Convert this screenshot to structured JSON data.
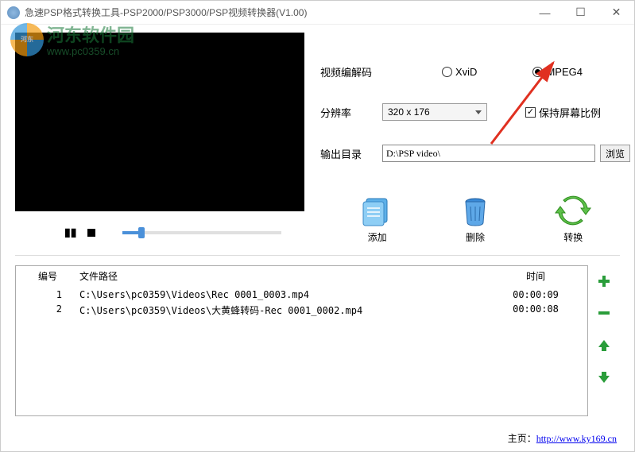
{
  "titlebar": {
    "title": "急速PSP格式转换工具-PSP2000/PSP3000/PSP视频转换器(V1.00)"
  },
  "watermark": {
    "brand": "河东软件园",
    "url": "www.pc0359.cn"
  },
  "settings": {
    "codec_label": "视频编解码",
    "codec_options": {
      "xvid": "XviD",
      "mpeg4": "MPEG4"
    },
    "codec_selected": "mpeg4",
    "resolution_label": "分辨率",
    "resolution_value": "320 x 176",
    "keep_aspect_label": "保持屏幕比例",
    "keep_aspect_checked": true,
    "outdir_label": "输出目录",
    "outdir_value": "D:\\PSP video\\",
    "browse_label": "浏览"
  },
  "actions": {
    "add": "添加",
    "delete": "删除",
    "convert": "转换"
  },
  "table": {
    "headers": {
      "num": "编号",
      "path": "文件路径",
      "time": "时间"
    },
    "rows": [
      {
        "num": "1",
        "path": "C:\\Users\\pc0359\\Videos\\Rec 0001_0003.mp4",
        "time": "00:00:09"
      },
      {
        "num": "2",
        "path": "C:\\Users\\pc0359\\Videos\\大黄蜂转码-Rec 0001_0002.mp4",
        "time": "00:00:08"
      }
    ]
  },
  "footer": {
    "label": "主页：",
    "url": "http://www.ky169.cn"
  }
}
